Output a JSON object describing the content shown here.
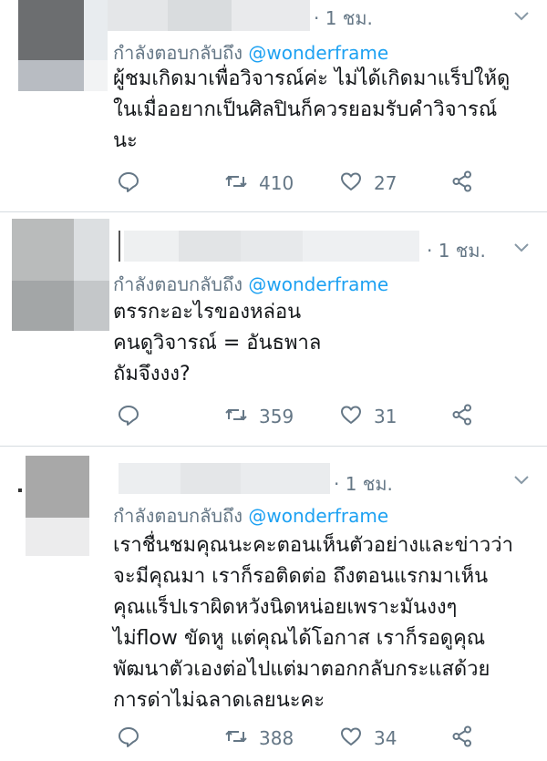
{
  "tweets": [
    {
      "time": "· 1 ชม.",
      "reply_prefix": "กำลังตอบกลับถึง",
      "reply_handle": "@wonderframe",
      "lines": [
        "ผู้ชมเกิดมาเพื่อวิจารณ์ค่ะ ไม่ได้เกิดมาแร็ปให้ดู",
        "ในเมื่ออยากเป็นศิลปินก็ควรยอมรับคำวิจารณ์",
        "นะ"
      ],
      "retweets": "410",
      "likes": "27"
    },
    {
      "time": "· 1 ชม.",
      "reply_prefix": "กำลังตอบกลับถึง",
      "reply_handle": "@wonderframe",
      "lines": [
        "ตรรกะอะไรของหล่อน",
        "คนดูวิจารณ์ = อันธพาล",
        "ถัมจึงงง?"
      ],
      "retweets": "359",
      "likes": "31"
    },
    {
      "time": "· 1 ชม.",
      "reply_prefix": "กำลังตอบกลับถึง",
      "reply_handle": "@wonderframe",
      "lines": [
        "เราชื่นชมคุณนะคะตอนเห็นตัวอย่างและข่าวว่า",
        "จะมีคุณมา เราก็รอติดต่อ ถึงตอนแรกมาเห็น",
        "คุณแร็ปเราผิดหวังนิดหน่อยเพราะมันงงๆ",
        "ไม่flow ขัดหู แต่คุณได้โอกาส เราก็รอดูคุณ",
        "พัฒนาตัวเองต่อไปแต่มาตอกกลับกระแสด้วย",
        "การด่าไม่ฉลาดเลยนะคะ"
      ],
      "retweets": "388",
      "likes": "34"
    }
  ],
  "icons": {
    "reply": "reply-icon",
    "retweet": "retweet-icon",
    "like": "heart-icon",
    "share": "share-icon",
    "menu": "chevron-down-icon"
  },
  "colors": {
    "link": "#1da1f2",
    "muted": "#657786",
    "text": "#14171a",
    "divider": "#d6dbe0"
  }
}
